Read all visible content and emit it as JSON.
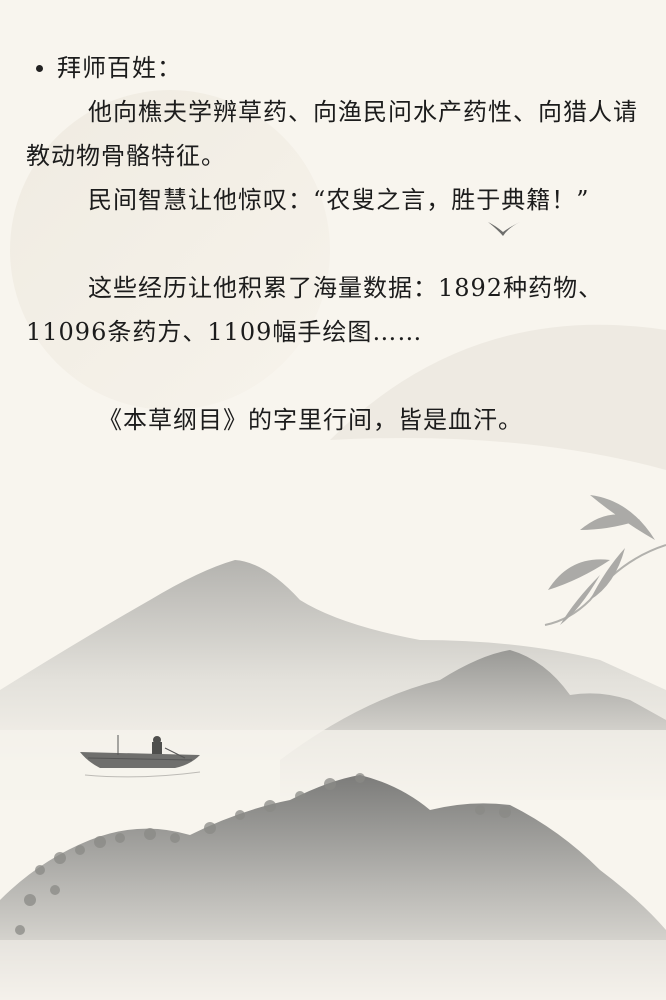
{
  "heading": "拜师百姓：",
  "paragraphs": {
    "p1": "他向樵夫学辨草药、向渔民问水产药性、向猎人请教动物骨骼特征。",
    "p2": "民间智慧让他惊叹：“农叟之言，胜于典籍！”",
    "p3": "这些经历让他积累了海量数据：1892种药物、11096条药方、1109幅手绘图……",
    "p4": "《本草纲目》的字里行间，皆是血汗。"
  },
  "icons": {
    "bullet": "bullet-dot",
    "bird": "flying-bird-icon",
    "boat": "boat-icon",
    "bamboo": "bamboo-leaves-icon"
  },
  "colors": {
    "background": "#f8f5ee",
    "ink": "#1c1c1c",
    "mountain_dark": "#9a9a98",
    "mountain_light": "#d6d4cf"
  }
}
